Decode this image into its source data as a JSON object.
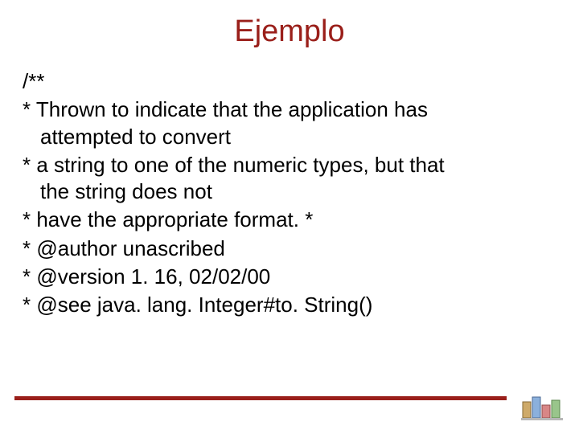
{
  "title": "Ejemplo",
  "open": "/**",
  "lines": [
    {
      "star": "*",
      "first": "Thrown to indicate that the application has",
      "cont": "attempted to convert",
      "justify": true
    },
    {
      "star": "*",
      "first": "a string to one of the numeric types, but that",
      "cont": "the string does not",
      "justify": true
    },
    {
      "star": "*",
      "first": "have the appropriate format. *"
    },
    {
      "star": "*",
      "first": "@author unascribed"
    },
    {
      "star": "*",
      "first": "@version 1. 16, 02/02/00"
    },
    {
      "star": "*",
      "first": "@see java. lang. Integer#to. String()"
    }
  ]
}
